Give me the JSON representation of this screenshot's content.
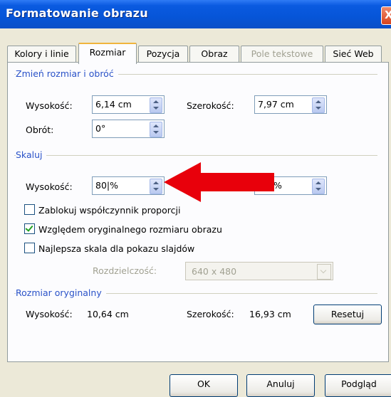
{
  "window": {
    "title": "Formatowanie obrazu",
    "close_glyph": "X"
  },
  "tabs": [
    {
      "label": "Kolory i linie",
      "active": false,
      "enabled": true
    },
    {
      "label": "Rozmiar",
      "active": true,
      "enabled": true
    },
    {
      "label": "Pozycja",
      "active": false,
      "enabled": true
    },
    {
      "label": "Obraz",
      "active": false,
      "enabled": true
    },
    {
      "label": "Pole tekstowe",
      "active": false,
      "enabled": false
    },
    {
      "label": "Sieć Web",
      "active": false,
      "enabled": true
    }
  ],
  "resize_rotate": {
    "section_title": "Zmień rozmiar i obróć",
    "height_label": "Wysokość:",
    "height_value": "6,14 cm",
    "width_label": "Szerokość:",
    "width_value": "7,97 cm",
    "rotation_label": "Obrót:",
    "rotation_value": "0°"
  },
  "scale": {
    "section_title": "Skaluj",
    "height_label": "Wysokość:",
    "height_value": "80|%",
    "width_value": "%",
    "lock_aspect_label": "Zablokuj współczynnik proporcji",
    "lock_aspect_checked": false,
    "relative_original_label": "Względem oryginalnego rozmiaru obrazu",
    "relative_original_checked": true,
    "best_scale_label": "Najlepsza skala dla pokazu slajdów",
    "best_scale_checked": false,
    "resolution_label": "Rozdzielczość:",
    "resolution_value": "640 x 480"
  },
  "original_size": {
    "section_title": "Rozmiar oryginalny",
    "height_label": "Wysokość:",
    "height_value": "10,64 cm",
    "width_label": "Szerokość:",
    "width_value": "16,93 cm",
    "reset_label": "Resetuj"
  },
  "buttons": {
    "ok": "OK",
    "cancel": "Anuluj",
    "preview": "Podgląd"
  },
  "annotation": {
    "arrow_color": "#e8000b"
  }
}
